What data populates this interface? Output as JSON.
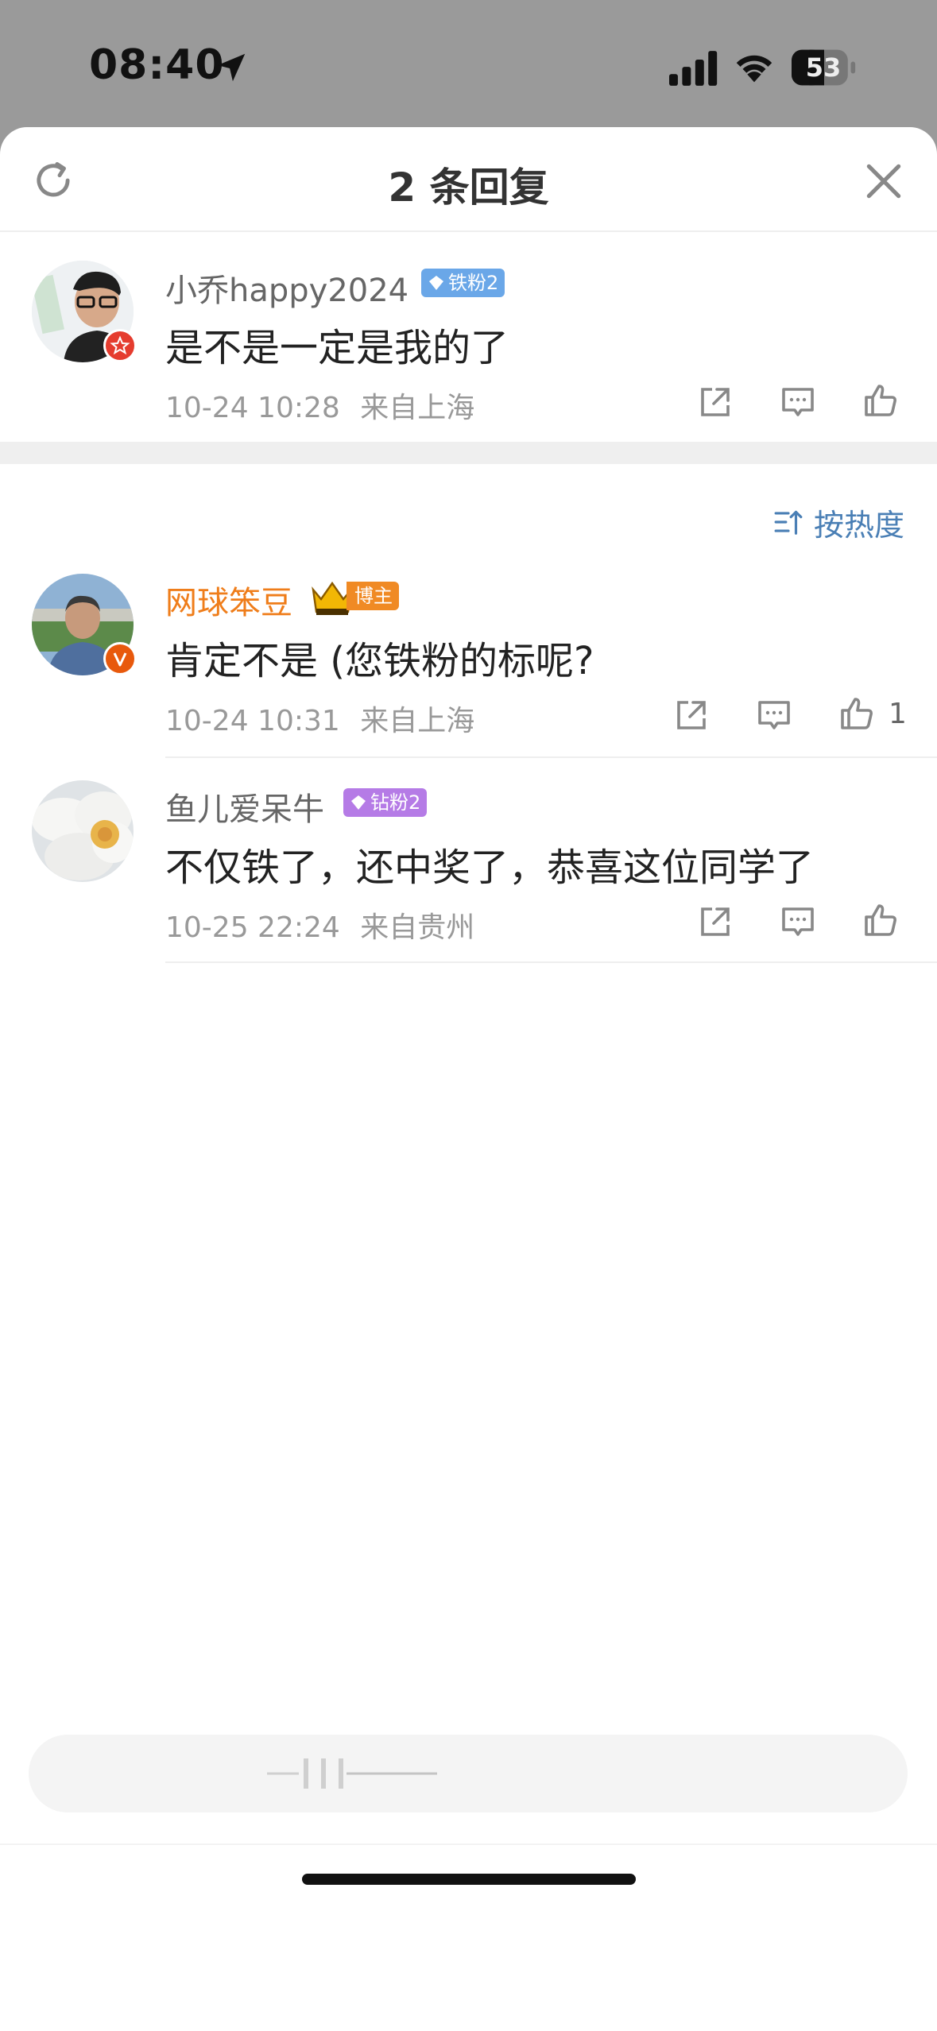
{
  "status_bar": {
    "time": "08:40",
    "battery": "53",
    "icons": [
      "location-arrow-icon",
      "cellular-signal-icon",
      "wifi-icon",
      "battery-icon"
    ]
  },
  "header": {
    "title": "2 条回复",
    "icons": [
      "refresh-icon",
      "close-icon"
    ]
  },
  "root_comment": {
    "username": "小乔happy2024",
    "badge": "铁粉2",
    "text": "是不是一定是我的了",
    "date": "10-24 10:28",
    "location": "来自上海",
    "icons": [
      "share-icon",
      "comment-icon",
      "like-icon"
    ]
  },
  "sort": {
    "label": "按热度",
    "icon": "sort-icon"
  },
  "replies": [
    {
      "username": "网球笨豆",
      "badge": "博主",
      "text": "肯定不是 (您铁粉的标呢?",
      "date": "10-24 10:31",
      "location": "来自上海",
      "likes": "1"
    },
    {
      "username": "鱼儿爱呆牛",
      "badge": "钻粉2",
      "text": "不仅铁了，还中奖了，恭喜这位同学了",
      "date": "10-25 22:24",
      "location": "来自贵州"
    }
  ],
  "colors": {
    "accent_blue": "#4a7fb5",
    "blogger_orange": "#ef7d1a",
    "iron_fan_badge": "#6aa7e8",
    "diamond_fan_badge": "#b57be6"
  }
}
